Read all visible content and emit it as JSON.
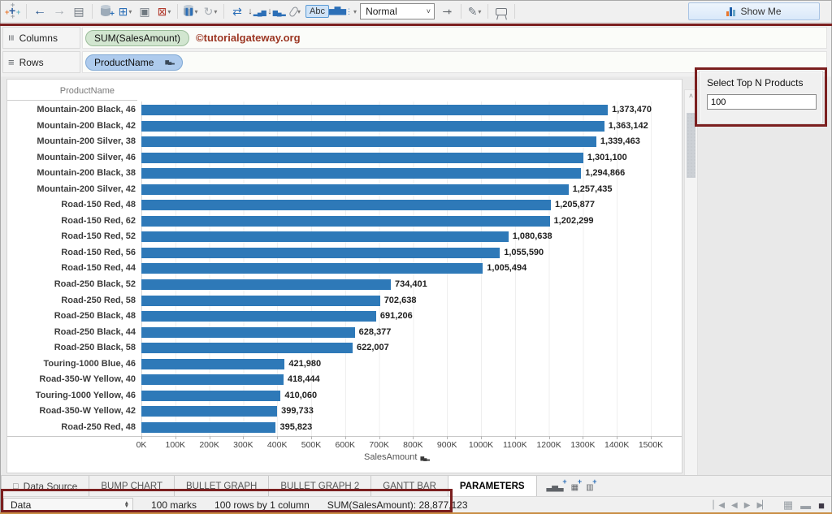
{
  "colors": {
    "bar": "#2e79b8",
    "annotation": "#7b1f1f",
    "pill_green": "#d2e6d0",
    "pill_blue": "#aecbed",
    "watermark": "#9c3723",
    "toolbar_bg": "#f0f0f0",
    "bottom_edge": "#c98e45"
  },
  "toolbar": {
    "fit_value": "Normal",
    "abc_label": "Abc",
    "show_me_label": "Show Me",
    "icons": [
      "tableau-logo",
      "back-arrow",
      "forward-arrow",
      "save",
      "add-data-source",
      "new-worksheet",
      "duplicate-sheet",
      "clear-sheet",
      "pause-auto-updates",
      "refresh-data",
      "swap-rows-columns",
      "sort-ascending",
      "sort-descending",
      "group-members",
      "show-mark-labels",
      "mark-type",
      "fit-select",
      "fix-axes-pin",
      "highlight-pen",
      "presentation-mode",
      "show-me"
    ]
  },
  "shelves": {
    "columns_label": "Columns",
    "rows_label": "Rows",
    "columns_pill": "SUM(SalesAmount)",
    "watermark": "©tutorialgateway.org",
    "rows_pill": "ProductName"
  },
  "parameter": {
    "title": "Select Top N Products",
    "value": "100"
  },
  "chart_data": {
    "type": "bar",
    "orientation": "horizontal",
    "header": "ProductName",
    "xlabel": "SalesAmount",
    "xlim": [
      0,
      1500000
    ],
    "grid": true,
    "x_ticks": [
      "0K",
      "100K",
      "200K",
      "300K",
      "400K",
      "500K",
      "600K",
      "700K",
      "800K",
      "900K",
      "1000K",
      "1100K",
      "1200K",
      "1300K",
      "1400K",
      "1500K"
    ],
    "categories": [
      "Mountain-200 Black, 46",
      "Mountain-200 Black, 42",
      "Mountain-200 Silver, 38",
      "Mountain-200 Silver, 46",
      "Mountain-200 Black, 38",
      "Mountain-200 Silver, 42",
      "Road-150 Red, 48",
      "Road-150 Red, 62",
      "Road-150 Red, 52",
      "Road-150 Red, 56",
      "Road-150 Red, 44",
      "Road-250 Black, 52",
      "Road-250 Red, 58",
      "Road-250 Black, 48",
      "Road-250 Black, 44",
      "Road-250 Black, 58",
      "Touring-1000 Blue, 46",
      "Road-350-W Yellow, 40",
      "Touring-1000 Yellow, 46",
      "Road-350-W Yellow, 42",
      "Road-250 Red, 48"
    ],
    "values": [
      1373470,
      1363142,
      1339463,
      1301100,
      1294866,
      1257435,
      1205877,
      1202299,
      1080638,
      1055590,
      1005494,
      734401,
      702638,
      691206,
      628377,
      622007,
      421980,
      418444,
      410060,
      399733,
      395823
    ],
    "value_labels": [
      "1,373,470",
      "1,363,142",
      "1,339,463",
      "1,301,100",
      "1,294,866",
      "1,257,435",
      "1,205,877",
      "1,202,299",
      "1,080,638",
      "1,055,590",
      "1,005,494",
      "734,401",
      "702,638",
      "691,206",
      "628,377",
      "622,007",
      "421,980",
      "418,444",
      "410,060",
      "399,733",
      "395,823"
    ]
  },
  "tabs": {
    "items": [
      {
        "label": "Data Source",
        "active": false,
        "slug": "data-source"
      },
      {
        "label": "BUMP CHART",
        "active": false,
        "slug": "bump-chart"
      },
      {
        "label": "BULLET GRAPH",
        "active": false,
        "slug": "bullet-graph"
      },
      {
        "label": "BULLET GRAPH 2",
        "active": false,
        "slug": "bullet-graph-2"
      },
      {
        "label": "GANTT BAR",
        "active": false,
        "slug": "gantt-bar"
      },
      {
        "label": "PARAMETERS",
        "active": true,
        "slug": "parameters"
      }
    ],
    "new_sheet_icons": [
      "new-worksheet",
      "new-dashboard",
      "new-story"
    ]
  },
  "status": {
    "selector": "Data",
    "marks": "100 marks",
    "size": "100 rows by 1 column",
    "sum": "SUM(SalesAmount): 28,877,123"
  }
}
